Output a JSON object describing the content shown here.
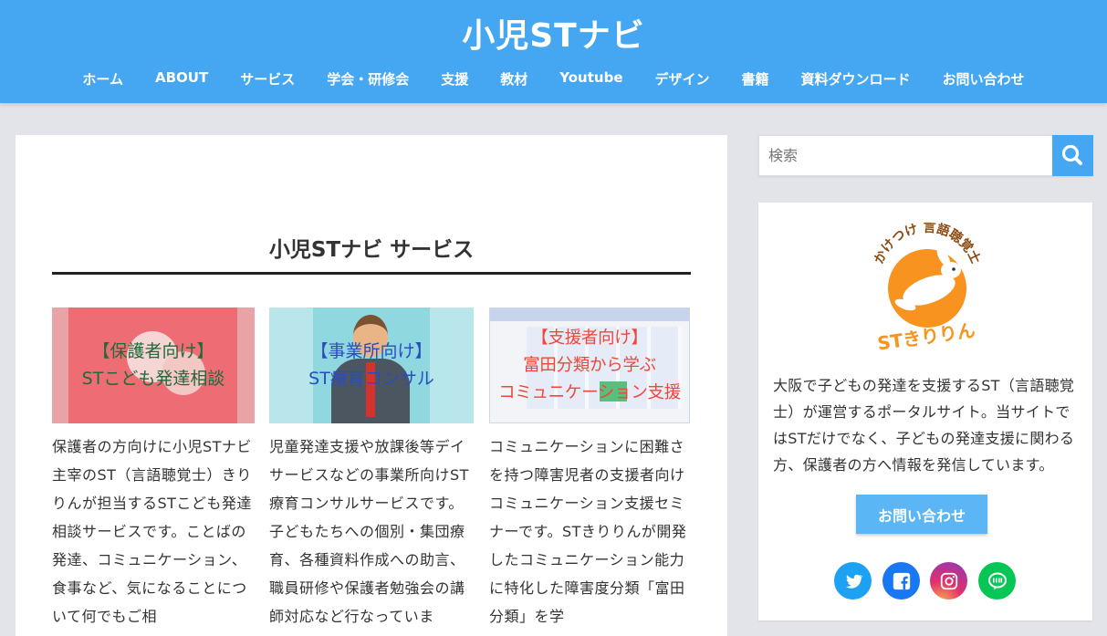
{
  "header": {
    "site_title": "小児STナビ",
    "nav": [
      "ホーム",
      "ABOUT",
      "サービス",
      "学会・研修会",
      "支援",
      "教材",
      "Youtube",
      "デザイン",
      "書籍",
      "資料ダウンロード",
      "お問い合わせ"
    ]
  },
  "main": {
    "page_title": "小児STナビ サービス",
    "cards": [
      {
        "thumb_line1": "【保護者向け】",
        "thumb_line2": "STこども発達相談",
        "desc": "保護者の方向けに小児STナビ主宰のST（言語聴覚士）きりりんが担当するSTこども発達相談サービスです。ことばの発達、コミュニケーション、食事など、気になることについて何でもご相"
      },
      {
        "thumb_line1": "【事業所向け】",
        "thumb_line2": "ST療育コンサル",
        "desc": "児童発達支援や放課後等デイサービスなどの事業所向けST療育コンサルサービスです。子どもたちへの個別・集団療育、各種資料作成への助言、職員研修や保護者勉強会の講師対応など行なっていま"
      },
      {
        "thumb_line1": "【支援者向け】",
        "thumb_line2": "富田分類から学ぶ",
        "thumb_line3": "コミュニケーション支援",
        "desc": "コミュニケーションに困難さを持つ障害児者の支援者向けコミュニケーション支援セミナーです。STきりりんが開発したコミュニケーション能力に特化した障害度分類「富田分類」を学"
      }
    ]
  },
  "sidebar": {
    "search_placeholder": "検索",
    "logo_arc_text": "かけつけ 言語聴覚士",
    "logo_name_text": "STきりりん",
    "about_text": "大阪で子どもの発達を支援するST（言語聴覚士）が運営するポータルサイト。当サイトではSTだけでなく、子どもの発達支援に関わる方、保護者の方へ情報を発信しています。",
    "contact_label": "お問い合わせ",
    "social": [
      "twitter-icon",
      "facebook-icon",
      "instagram-icon",
      "line-icon"
    ]
  },
  "colors": {
    "header_bg": "#45a6f2",
    "accent": "#45a6f2",
    "logo_orange": "#f7931e"
  }
}
